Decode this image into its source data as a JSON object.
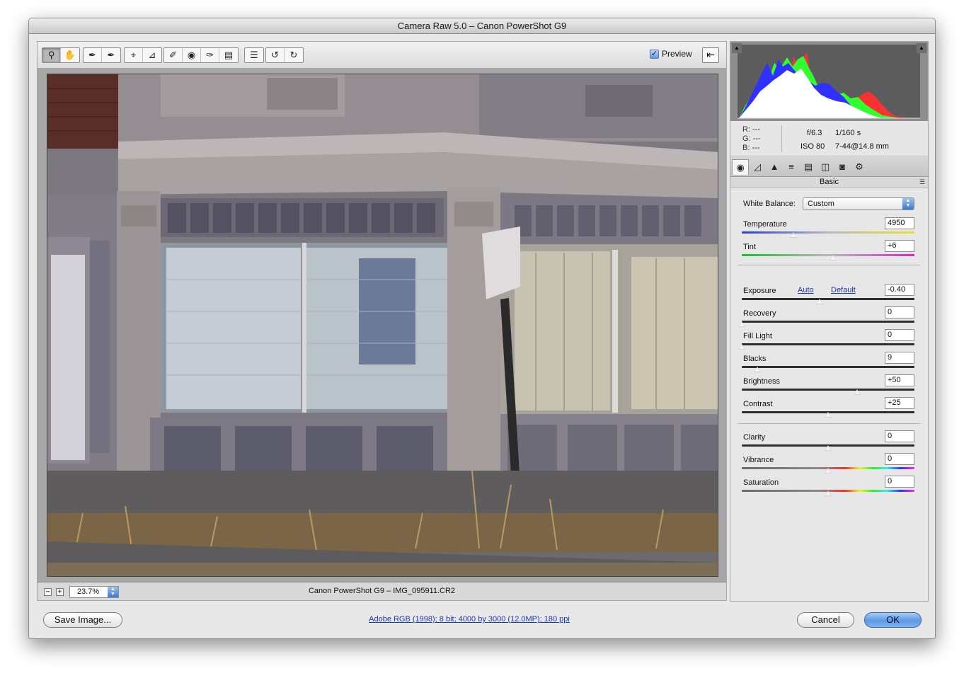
{
  "window": {
    "title": "Camera Raw 5.0  –  Canon PowerShot G9"
  },
  "toolbar": {
    "tools": [
      {
        "name": "zoom-tool",
        "glyph": "🔍"
      },
      {
        "name": "hand-tool",
        "glyph": "✋"
      },
      {
        "name": "white-balance-tool",
        "glyph": "✒"
      },
      {
        "name": "color-sampler-tool",
        "glyph": "✒"
      },
      {
        "name": "crop-tool",
        "glyph": "⌗"
      },
      {
        "name": "straighten-tool",
        "glyph": "⊿"
      },
      {
        "name": "spot-removal-tool",
        "glyph": "✎"
      },
      {
        "name": "red-eye-tool",
        "glyph": "◉"
      },
      {
        "name": "adjustment-brush-tool",
        "glyph": "✐"
      },
      {
        "name": "graduated-filter-tool",
        "glyph": "▥"
      },
      {
        "name": "preferences-tool",
        "glyph": "☰"
      },
      {
        "name": "rotate-ccw-tool",
        "glyph": "↺"
      },
      {
        "name": "rotate-cw-tool",
        "glyph": "↻"
      }
    ],
    "preview_label": "Preview",
    "preview_checked": true
  },
  "status": {
    "zoom_out": "−",
    "zoom_in": "+",
    "zoom_value": "23.7%",
    "filename": "Canon PowerShot G9  –  IMG_095911.CR2"
  },
  "info": {
    "r": "R:  ---",
    "g": "G:  ---",
    "b": "B:  ---",
    "aperture": "f/6.3",
    "shutter": "1/160 s",
    "iso": "ISO 80",
    "lens": "7-44@14.8 mm"
  },
  "panel": {
    "tabs": [
      "◉",
      "◿",
      "▲",
      "≡",
      "▤",
      "◫",
      "◙",
      "⚙"
    ],
    "section_title": "Basic",
    "menu_icon": "☰",
    "white_balance_label": "White Balance:",
    "white_balance_value": "Custom",
    "auto_label": "Auto",
    "default_label": "Default",
    "sliders": [
      {
        "label": "Temperature",
        "value": "4950",
        "fraction": 0.3,
        "track": "temp"
      },
      {
        "label": "Tint",
        "value": "+6",
        "fraction": 0.53,
        "track": "tint"
      },
      {
        "label": "Exposure",
        "value": "-0.40",
        "fraction": 0.45,
        "track": "plain"
      },
      {
        "label": "Recovery",
        "value": "0",
        "fraction": 0.0,
        "track": "plain"
      },
      {
        "label": "Fill Light",
        "value": "0",
        "fraction": 0.0,
        "track": "plain"
      },
      {
        "label": "Blacks",
        "value": "9",
        "fraction": 0.09,
        "track": "plain"
      },
      {
        "label": "Brightness",
        "value": "+50",
        "fraction": 0.67,
        "track": "plain"
      },
      {
        "label": "Contrast",
        "value": "+25",
        "fraction": 0.5,
        "track": "plain"
      },
      {
        "label": "Clarity",
        "value": "0",
        "fraction": 0.5,
        "track": "plain"
      },
      {
        "label": "Vibrance",
        "value": "0",
        "fraction": 0.5,
        "track": "vib"
      },
      {
        "label": "Saturation",
        "value": "0",
        "fraction": 0.5,
        "track": "sat"
      }
    ]
  },
  "footer": {
    "save_label": "Save Image...",
    "workflow_label": "Adobe RGB (1998); 8 bit; 4000 by 3000 (12.0MP); 180 ppi",
    "cancel_label": "Cancel",
    "ok_label": "OK"
  }
}
